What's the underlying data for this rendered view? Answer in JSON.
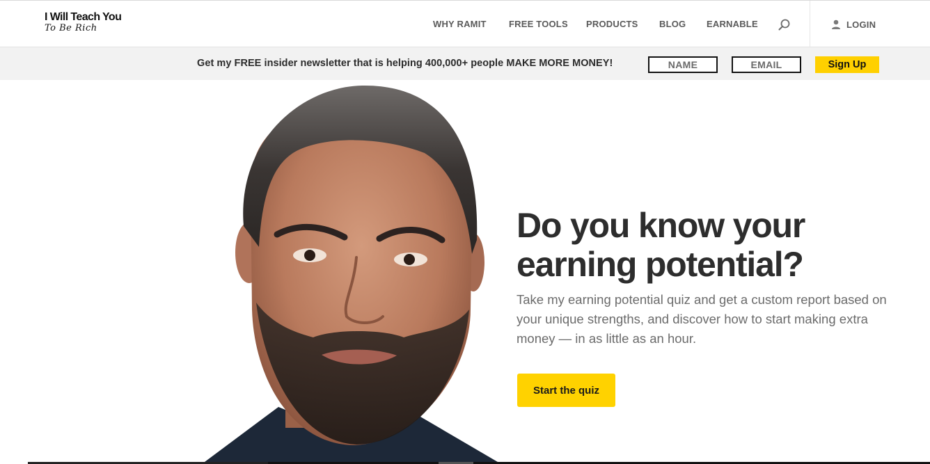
{
  "header": {
    "logo_line1": "I Will Teach You",
    "logo_line2": "To Be Rich",
    "nav": [
      {
        "label": "WHY RAMIT"
      },
      {
        "label": "FREE TOOLS"
      },
      {
        "label": "PRODUCTS"
      },
      {
        "label": "BLOG"
      },
      {
        "label": "EARNABLE"
      }
    ],
    "search_icon": "search-icon",
    "login_icon": "user-icon",
    "login_label": "LOGIN"
  },
  "newsletter": {
    "text": "Get my FREE insider newsletter that is helping 400,000+ people MAKE MORE MONEY!",
    "name_placeholder": "NAME",
    "email_placeholder": "EMAIL",
    "signup_label": "Sign Up"
  },
  "hero": {
    "headline": "Do you know your earning potential?",
    "subtext": "Take my earning potential quiz and get a custom report based on your unique strengths, and discover how to start making extra money — in as little as an hour.",
    "cta_label": "Start the quiz"
  },
  "colors": {
    "accent": "#ffd200",
    "text_dark": "#2d2d2d",
    "text_muted": "#6b6b6b",
    "bar_bg": "#f2f2f2"
  }
}
